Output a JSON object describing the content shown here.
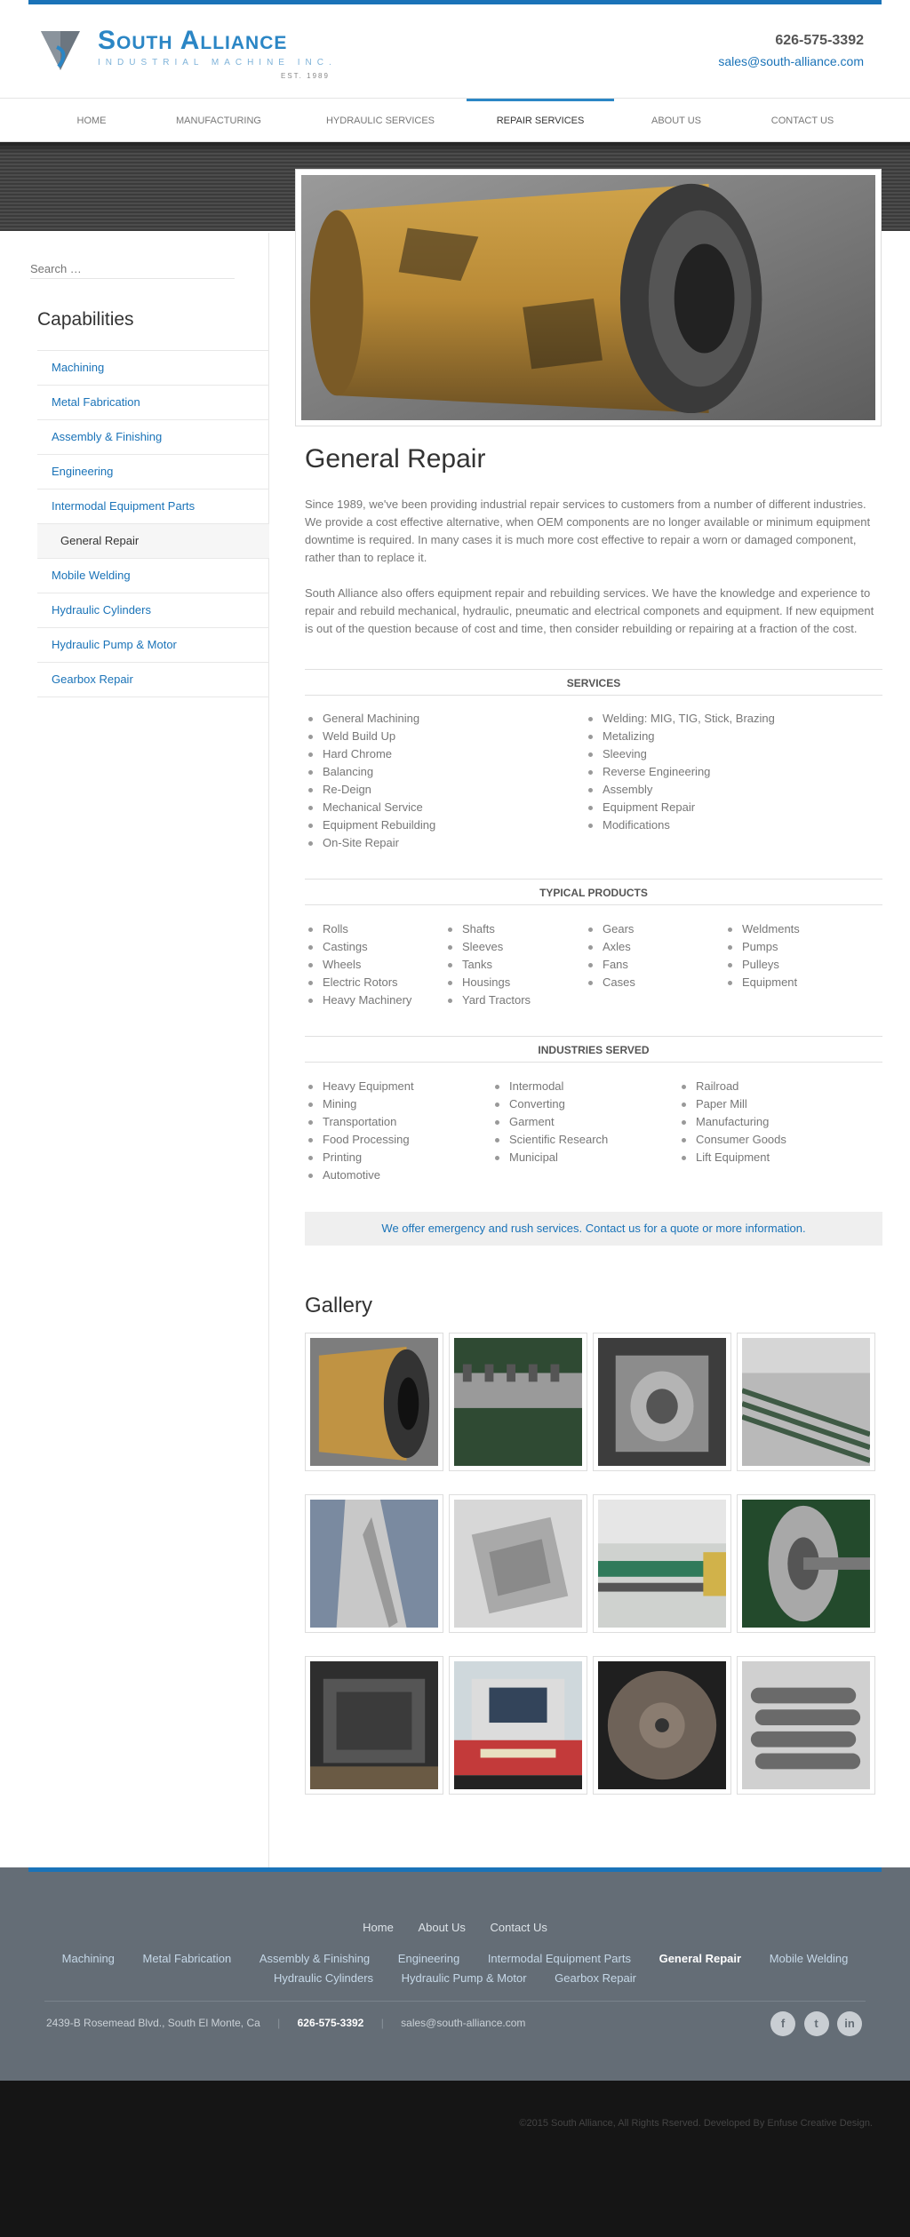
{
  "brand": {
    "title": "South Alliance",
    "subtitle": "INDUSTRIAL MACHINE INC.",
    "established": "EST. 1989",
    "phone": "626-575-3392",
    "email": "sales@south-alliance.com"
  },
  "nav": {
    "items": [
      {
        "label": "HOME"
      },
      {
        "label": "MANUFACTURING"
      },
      {
        "label": "HYDRAULIC SERVICES"
      },
      {
        "label": "REPAIR SERVICES",
        "active": true
      },
      {
        "label": "ABOUT US"
      },
      {
        "label": "CONTACT US"
      }
    ]
  },
  "sidebar": {
    "search_placeholder": "Search …",
    "capabilities_title": "Capabilities",
    "items": [
      {
        "label": "Machining"
      },
      {
        "label": "Metal Fabrication"
      },
      {
        "label": "Assembly & Finishing"
      },
      {
        "label": "Engineering"
      },
      {
        "label": "Intermodal Equipment Parts"
      },
      {
        "label": "General Repair",
        "active": true
      },
      {
        "label": "Mobile Welding"
      },
      {
        "label": "Hydraulic Cylinders"
      },
      {
        "label": "Hydraulic Pump & Motor"
      },
      {
        "label": "Gearbox Repair"
      }
    ]
  },
  "main": {
    "title": "General Repair",
    "para1": "Since 1989, we've been providing industrial repair services to customers from a number of different industries. We provide a cost effective alternative, when OEM components are no longer available or minimum equipment downtime is required. In many cases it is much more cost effective to repair a worn or damaged component, rather than to replace it.",
    "para2": "South Alliance also offers equipment repair and rebuilding services. We have the knowledge and experience to repair and rebuild mechanical, hydraulic, pneumatic and electrical componets and equipment. If new equipment is out of the question because of cost and time, then consider rebuilding or repairing at a fraction of the cost.",
    "services": {
      "heading": "SERVICES",
      "col1": [
        "General Machining",
        "Weld Build Up",
        "Hard Chrome",
        "Balancing",
        "Re-Deign",
        "Mechanical Service",
        "Equipment Rebuilding",
        "On-Site Repair"
      ],
      "col2": [
        "Welding: MIG, TIG, Stick, Brazing",
        "Metalizing",
        "Sleeving",
        "Reverse Engineering",
        "Assembly",
        "Equipment Repair",
        "Modifications"
      ]
    },
    "products": {
      "heading": "TYPICAL PRODUCTS",
      "col1": [
        "Rolls",
        "Castings",
        "Wheels",
        "Electric Rotors",
        "Heavy Machinery"
      ],
      "col2": [
        "Shafts",
        "Sleeves",
        "Tanks",
        "Housings",
        "Yard Tractors"
      ],
      "col3": [
        "Gears",
        "Axles",
        "Fans",
        "Cases"
      ],
      "col4": [
        "Weldments",
        "Pumps",
        "Pulleys",
        "Equipment"
      ]
    },
    "industries": {
      "heading": "INDUSTRIES SERVED",
      "col1": [
        "Heavy Equipment",
        "Mining",
        "Transportation",
        "Food Processing",
        "Printing",
        "Automotive"
      ],
      "col2": [
        "Intermodal",
        "Converting",
        "Garment",
        "Scientific Research",
        "Municipal"
      ],
      "col3": [
        "Railroad",
        "Paper Mill",
        "Manufacturing",
        "Consumer Goods",
        "Lift Equipment"
      ]
    },
    "cta": "We offer emergency and rush services. Contact us for a quote or more information.",
    "gallery_title": "Gallery"
  },
  "footer": {
    "links_primary": [
      "Home",
      "About Us",
      "Contact Us"
    ],
    "links_capabilities": [
      "Machining",
      "Metal Fabrication",
      "Assembly & Finishing",
      "Engineering",
      "Intermodal Equipment Parts",
      "General Repair",
      "Mobile Welding",
      "Hydraulic Cylinders",
      "Hydraulic Pump & Motor",
      "Gearbox Repair"
    ],
    "active_capability": "General Repair",
    "address": "2439-B Rosemead Blvd., South El Monte, Ca",
    "phone": "626-575-3392",
    "email": "sales@south-alliance.com",
    "social": [
      {
        "icon": "facebook-icon",
        "glyph": "f"
      },
      {
        "icon": "twitter-icon",
        "glyph": "t"
      },
      {
        "icon": "linkedin-icon",
        "glyph": "in"
      }
    ],
    "copyright": "©2015 South Alliance, All Rights Rserved. Developed By Enfuse Creative Design."
  },
  "colors": {
    "accent": "#1a73b8",
    "footer_bg": "#646d76",
    "bottom_bg": "#151515"
  }
}
